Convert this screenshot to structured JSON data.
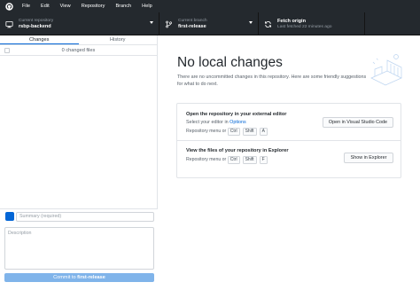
{
  "menubar": {
    "items": [
      "File",
      "Edit",
      "View",
      "Repository",
      "Branch",
      "Help"
    ]
  },
  "toolbar": {
    "repo_label": "Current repository",
    "repo_value": "rsbp-backend",
    "branch_label": "Current branch",
    "branch_value": "first-release",
    "fetch_label": "Fetch origin",
    "fetch_sub": "Last fetched 22 minutes ago"
  },
  "sidebar": {
    "tabs": [
      "Changes",
      "History"
    ],
    "changes_count": "0 changed files",
    "summary_placeholder": "Summary (required)",
    "description_placeholder": "Description",
    "commit_prefix": "Commit to",
    "commit_branch": "first-release"
  },
  "main": {
    "title": "No local changes",
    "subtitle": "There are no uncommitted changes in this repository. Here are some friendly suggestions for what to do next.",
    "suggestions": [
      {
        "title": "Open the repository in your external editor",
        "desc_prefix": "Select your editor in",
        "desc_link": "Options",
        "shortcut_prefix": "Repository menu or",
        "keys": [
          "Ctrl",
          "Shift",
          "A"
        ],
        "button": "Open in Visual Studio Code"
      },
      {
        "title": "View the files of your repository in Explorer",
        "shortcut_prefix": "Repository menu or",
        "keys": [
          "Ctrl",
          "Shift",
          "F"
        ],
        "button": "Show in Explorer"
      }
    ]
  },
  "colors": {
    "toolbar_bg": "#24292e",
    "accent": "#0366d6",
    "commit_button": "#80b4ea"
  },
  "icons": {
    "logo": "github-logo-icon",
    "repo": "desktop-icon",
    "branch": "branch-icon",
    "fetch": "sync-icon"
  }
}
